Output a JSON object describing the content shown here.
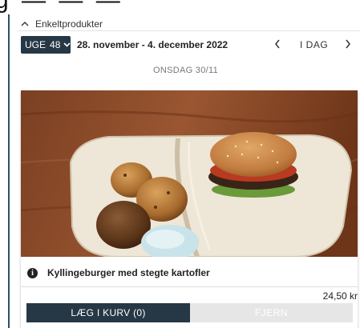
{
  "top_cutoff_text": "g — — —",
  "section": {
    "toggle_label": "Enkeltprodukter"
  },
  "week_nav": {
    "week_prefix": "UGE",
    "week_number": "48",
    "date_range": "28. november - 4. december 2022",
    "prev_symbol": "‹",
    "today_label": "I DAG",
    "next_symbol": "›"
  },
  "day_label": "ONSDAG 30/11",
  "product": {
    "name": "Kyllingeburger med stegte kartofler",
    "price": "24,50 kr",
    "add_button": "LÆG I KURV (0)",
    "remove_button": "FJERN"
  },
  "colors": {
    "primary_dark": "#263845",
    "disabled_button": "#e6e6e6",
    "frame_border": "#2f4f63"
  },
  "icons": {
    "collapse": "chevron-up-icon",
    "week_dropdown": "chevron-down-icon",
    "info": "info-circle-icon"
  }
}
